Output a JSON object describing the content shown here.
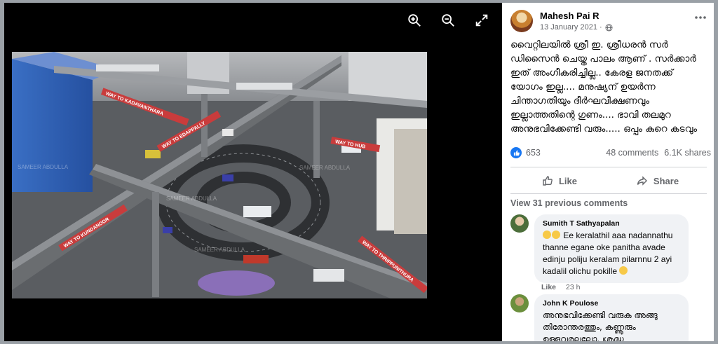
{
  "viewer": {
    "zoom_in": "zoom-in",
    "zoom_out": "zoom-out",
    "fullscreen": "fullscreen",
    "photo_labels": {
      "kadavanthara": "WAY TO KADAVANTHARA",
      "edappally": "WAY TO EDAPPALLY",
      "hub": "WAY TO HUB",
      "kundannoor": "WAY TO KUNDANOOR",
      "thrippunithura": "WAY TO THRIPPUNITHURA",
      "watermark": "SAMEER ABDULLA"
    }
  },
  "post": {
    "author": "Mahesh Pai R",
    "date": "13 January 2021 · ",
    "text": "വൈറ്റിലയിൽ ശ്രീ ഇ. ശ്രീധരൻ സർ ഡിസൈൻ ചെയ്ത പാലം ആണ് . സർക്കാർ ഇത് അംഗീകരിച്ചില്ല.. കേരള ജനതക്ക് യോഗം ഇല്ല.... മനുഷ്യന് ഉയർന്ന ചിന്താഗതിയും ദീർഘവീക്ഷണവും ഇല്ലാത്തതിന്റെ ഗുണം.... ഭാവി തലമുറ അനുഭവിക്കേണ്ടി വരും..... ഒപ്പം കുറെ കടവും",
    "like_count": "653",
    "comments_count": "48 comments",
    "shares_count": "6.1K shares",
    "like_label": "Like",
    "share_label": "Share",
    "view_previous": "View 31 previous comments"
  },
  "comments": [
    {
      "author": "Sumith T Sathyapalan",
      "text": "Ee keralathil aaa nadannathu thanne egane oke panitha avade edinju poliju keralam pilarnnu 2 ayi kadalil olichu pokille",
      "like_label": "Like",
      "time": "23 h"
    },
    {
      "author": "John K Poulose",
      "text": "അനുഭവിക്കേണ്ടി വരുക അങ്ങു തിരോന്തരത്തും, കണ്ണൂരും ഉള്ളവരല്ലലോ, ശ്രദ്ധ"
    }
  ],
  "colors": {
    "accent": "#1877f2",
    "viewer_bg": "#000000",
    "panel_bg": "#ffffff",
    "bubble_bg": "#f0f2f5",
    "secondary_text": "#65676b"
  }
}
